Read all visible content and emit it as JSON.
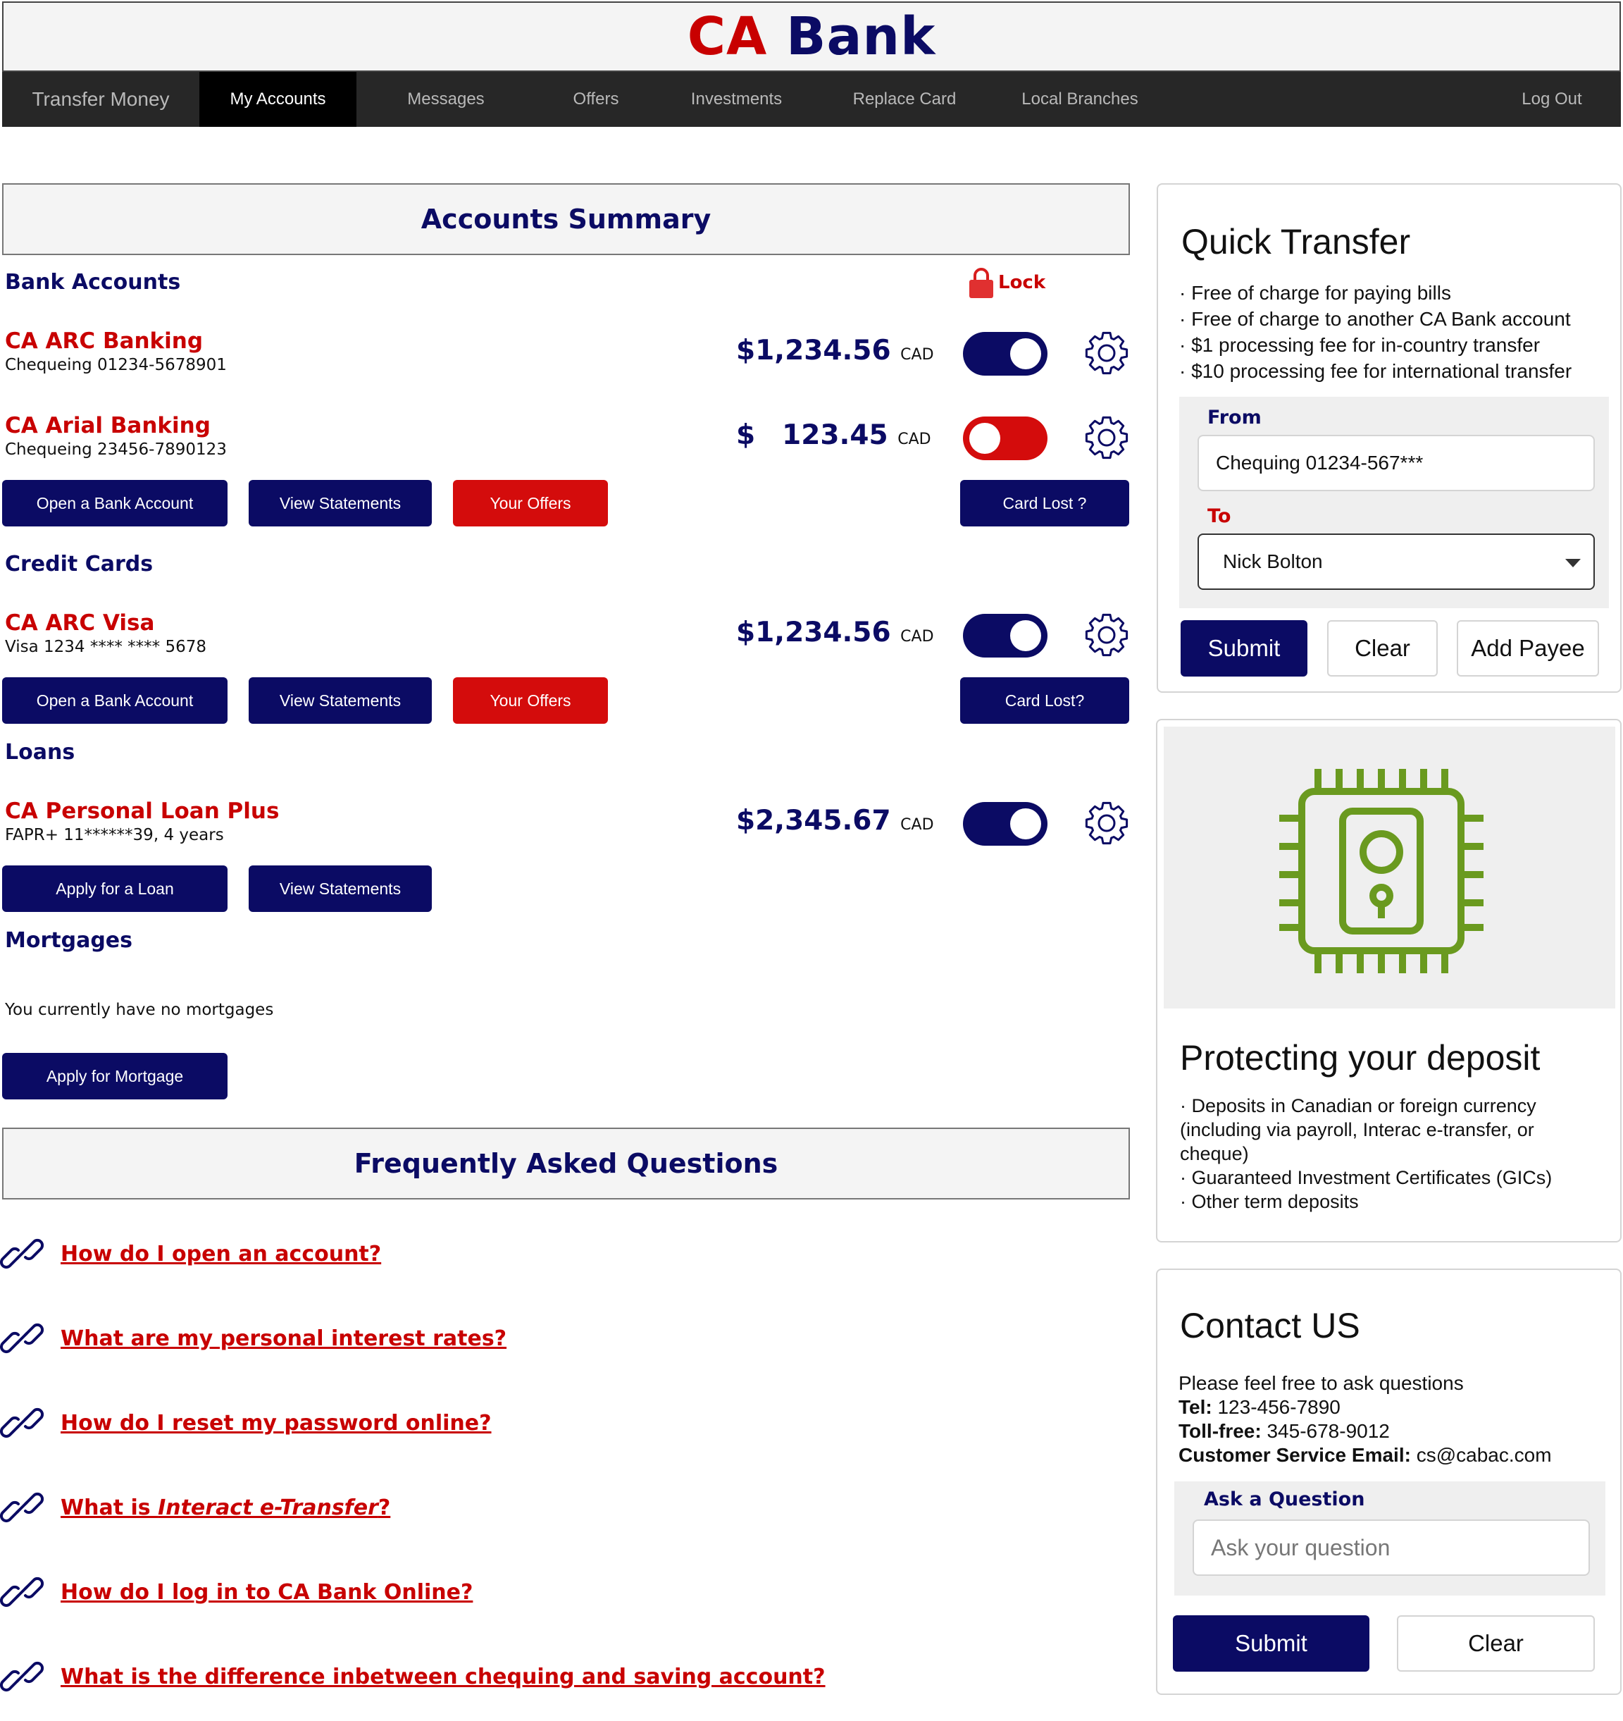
{
  "brand": {
    "part1": "CA",
    "part2": "Bank",
    "color_red": "#c80000",
    "color_navy": "#0b0b64"
  },
  "nav": {
    "items": [
      "Transfer Money",
      "My Accounts",
      "Messages",
      "Offers",
      "Investments",
      "Replace Card",
      "Local Branches"
    ],
    "active": "My Accounts",
    "logout": "Log Out"
  },
  "summary": {
    "title": "Accounts Summary",
    "lock_label": "Lock",
    "bank": {
      "heading": "Bank Accounts",
      "accounts": [
        {
          "name": "CA ARC Banking",
          "sub": "Chequeing 01234-5678901",
          "amount": "$1,234.56",
          "currency": "CAD",
          "locked": false
        },
        {
          "name": "CA Arial Banking",
          "sub": "Chequeing 23456-7890123",
          "amount_sign": "$",
          "amount": "123.45",
          "currency": "CAD",
          "locked": true
        }
      ],
      "buttons": [
        "Open a Bank Account",
        "View Statements",
        "Your Offers"
      ],
      "card_lost": "Card Lost ?"
    },
    "credit": {
      "heading": "Credit Cards",
      "account": {
        "name": "CA ARC Visa",
        "sub": "Visa 1234 **** **** 5678",
        "amount": "$1,234.56",
        "currency": "CAD",
        "locked": false
      },
      "buttons": [
        "Open a Bank Account",
        "View Statements",
        "Your Offers"
      ],
      "card_lost": "Card Lost?"
    },
    "loans": {
      "heading": "Loans",
      "account": {
        "name": "CA Personal Loan Plus",
        "sub": "FAPR+ 11******39, 4 years",
        "amount": "$2,345.67",
        "currency": "CAD",
        "locked": false
      },
      "buttons": [
        "Apply for a Loan",
        "View Statements"
      ]
    },
    "mortgages": {
      "heading": "Mortgages",
      "empty": "You currently have no mortgages",
      "button": "Apply for Mortgage"
    }
  },
  "faq": {
    "title": "Frequently Asked Questions",
    "items": [
      "How do I open an account?",
      "What are my personal interest rates?",
      "How do I reset my password online?",
      {
        "pre": "What is ",
        "em": "Interact e-Transfer",
        "post": "?"
      },
      "How do I log in to CA Bank Online?",
      "What is the difference inbetween chequing and saving account?"
    ]
  },
  "quick_transfer": {
    "title": "Quick Transfer",
    "bullets": [
      "Free of charge for paying bills",
      "Free of charge to another CA Bank account",
      "$1 processing fee for in-country transfer",
      "$10 processing fee for international transfer"
    ],
    "from_label": "From",
    "from_value": "Chequing 01234-567***",
    "to_label": "To",
    "to_value": "Nick Bolton",
    "submit": "Submit",
    "clear": "Clear",
    "add_payee": "Add Payee"
  },
  "deposit": {
    "title": "Protecting your deposit",
    "bullets": [
      "Deposits in Canadian or foreign currency (including via payroll, Interac e-transfer, or cheque)",
      "Guaranteed Investment Certificates (GICs)",
      "Other term deposits"
    ],
    "icon": "secure-chip-icon",
    "icon_color": "#6a9a1f"
  },
  "contact": {
    "title": "Contact US",
    "intro": "Please feel free to ask questions",
    "tel_label": "Tel:",
    "tel": "123-456-7890",
    "tollfree_label": "Toll-free:",
    "tollfree": "345-678-9012",
    "email_label": "Customer Service Email:",
    "email": "cs@cabac.com",
    "ask_label": "Ask a Question",
    "ask_placeholder": "Ask your question",
    "submit": "Submit",
    "clear": "Clear"
  }
}
